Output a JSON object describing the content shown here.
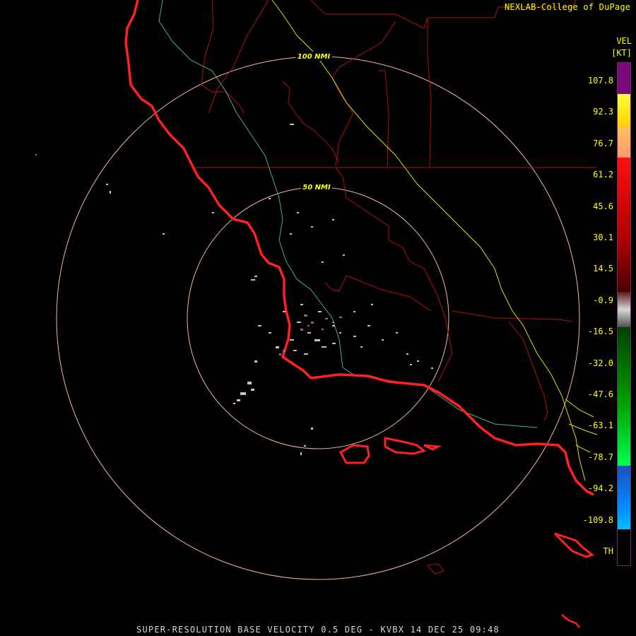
{
  "credit": "NEXLAB-College of DuPage",
  "legend": {
    "product": "VEL",
    "units": "[KT]",
    "ticks": [
      "107.8",
      "92.3",
      "76.7",
      "61.2",
      "45.6",
      "30.1",
      "14.5",
      "-0.9",
      "-16.5",
      "-32.0",
      "-47.6",
      "-63.1",
      "-78.7",
      "-94.2",
      "-109.8",
      "TH"
    ],
    "colors": {
      "purple": "#7a0a7a",
      "yellow": "#ffff00",
      "orange": "#ff9a50",
      "red": "#ff0000",
      "dark_red": "#6a0000",
      "gray": "#b0b0b0",
      "dark_green": "#006400",
      "green": "#00e000",
      "blue": "#1a60d0",
      "cyan": "#00b8ff"
    }
  },
  "rings": [
    "100 NMI",
    "50 NMI"
  ],
  "footer": "SUPER-RESOLUTION BASE VELOCITY 0.5 DEG - KVBX 14 DEC 25 09:48"
}
